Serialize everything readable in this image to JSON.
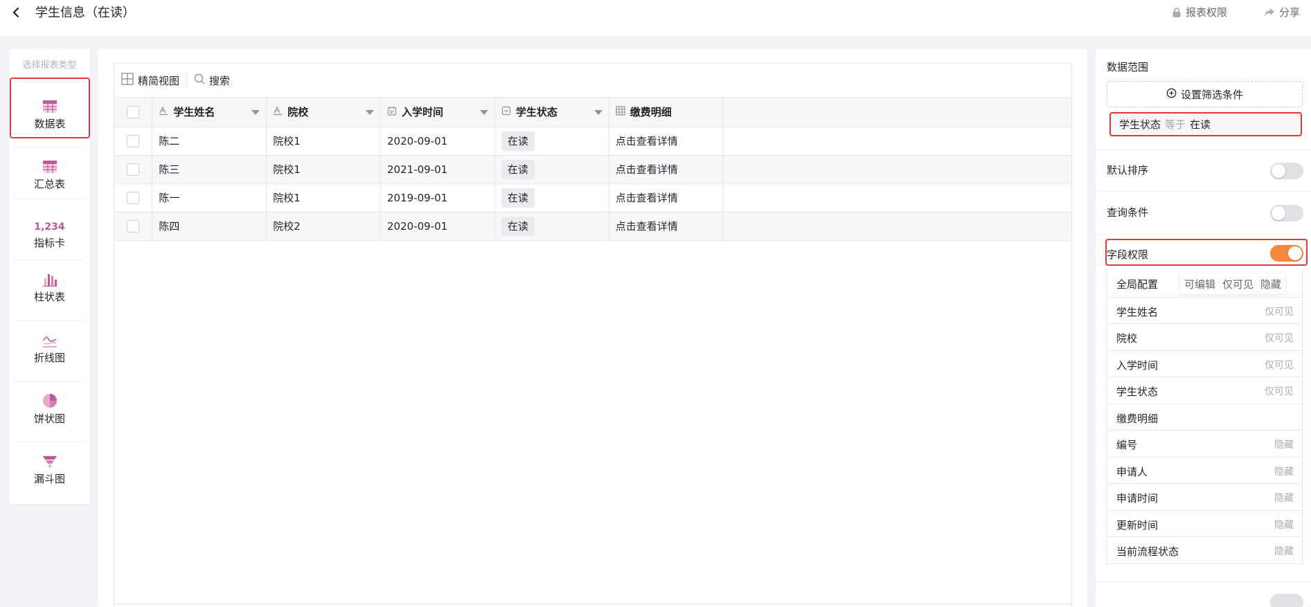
{
  "header": {
    "back_icon": "chevron-left-icon",
    "title": "学生信息（在读）",
    "report_perm_label": "报表权限",
    "share_label": "分享"
  },
  "left_rail": {
    "title": "选择报表类型",
    "items": [
      {
        "label": "数据表",
        "icon": "data-table-icon",
        "active": true
      },
      {
        "label": "汇总表",
        "icon": "summary-table-icon"
      },
      {
        "label": "指标卡",
        "icon": "metric-card-icon",
        "icon_text": "1,234"
      },
      {
        "label": "柱状表",
        "icon": "bar-chart-icon"
      },
      {
        "label": "折线图",
        "icon": "line-chart-icon"
      },
      {
        "label": "饼状图",
        "icon": "pie-chart-icon"
      },
      {
        "label": "漏斗图",
        "icon": "funnel-chart-icon"
      }
    ]
  },
  "toolbar": {
    "compact_view_label": "精简视图",
    "search_label": "搜索"
  },
  "table": {
    "columns": [
      {
        "label": "学生姓名",
        "icon": "text-field-icon"
      },
      {
        "label": "院校",
        "icon": "text-field-icon"
      },
      {
        "label": "入学时间",
        "icon": "calendar-icon"
      },
      {
        "label": "学生状态",
        "icon": "select-field-icon"
      },
      {
        "label": "缴费明细",
        "icon": "subtable-icon"
      }
    ],
    "rows": [
      {
        "name": "陈二",
        "school": "院校1",
        "date": "2020-09-01",
        "status": "在读",
        "detail": "点击查看详情"
      },
      {
        "name": "陈三",
        "school": "院校1",
        "date": "2021-09-01",
        "status": "在读",
        "detail": "点击查看详情"
      },
      {
        "name": "陈一",
        "school": "院校1",
        "date": "2019-09-01",
        "status": "在读",
        "detail": "点击查看详情"
      },
      {
        "name": "陈四",
        "school": "院校2",
        "date": "2020-09-01",
        "status": "在读",
        "detail": "点击查看详情"
      }
    ]
  },
  "right_panel": {
    "data_range_label": "数据范围",
    "add_filter_label": "设置筛选条件",
    "filter": {
      "field": "学生状态",
      "op": "等于",
      "value": "在读"
    },
    "default_sort_label": "默认排序",
    "default_sort_on": false,
    "query_cond_label": "查询条件",
    "query_cond_on": false,
    "field_perm_label": "字段权限",
    "field_perm_on": true,
    "global_config_label": "全局配置",
    "global_options": [
      "可编辑",
      "仅可见",
      "隐藏"
    ],
    "fields": [
      {
        "name": "学生姓名",
        "perm": "仅可见"
      },
      {
        "name": "院校",
        "perm": "仅可见"
      },
      {
        "name": "入学时间",
        "perm": "仅可见"
      },
      {
        "name": "学生状态",
        "perm": "仅可见"
      },
      {
        "name": "缴费明细",
        "perm": ""
      },
      {
        "name": "编号",
        "perm": "隐藏"
      },
      {
        "name": "申请人",
        "perm": "隐藏"
      },
      {
        "name": "申请时间",
        "perm": "隐藏"
      },
      {
        "name": "更新时间",
        "perm": "隐藏"
      },
      {
        "name": "当前流程状态",
        "perm": "隐藏"
      }
    ]
  },
  "colors": {
    "accent_orange": "#f7883b",
    "highlight_red": "#e8343b",
    "icon_purple": "#c2579b"
  }
}
